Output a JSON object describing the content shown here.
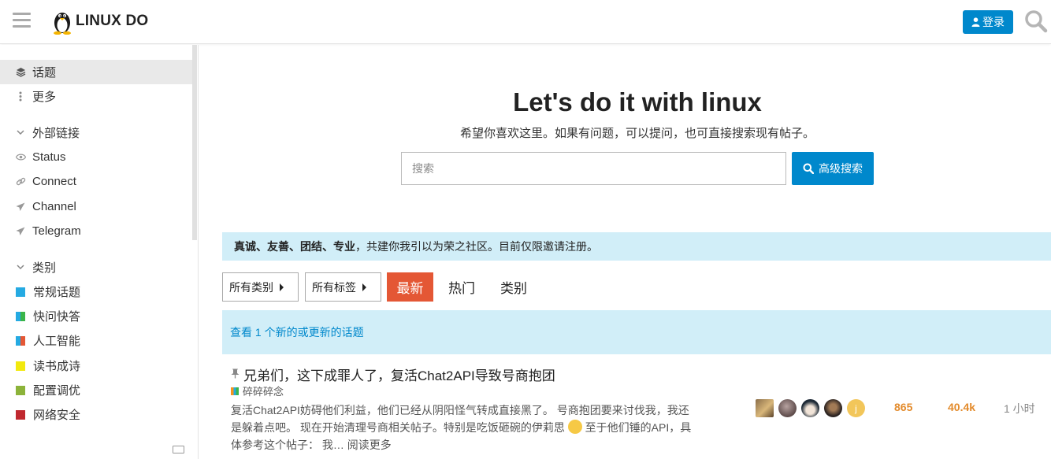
{
  "header": {
    "logo_text": "LINUX DO",
    "login_label": "登录"
  },
  "sidebar": {
    "items": [
      {
        "label": "话题",
        "icon": "layers-icon",
        "active": true
      },
      {
        "label": "更多",
        "icon": "vertical-ellipsis-icon",
        "active": false
      }
    ],
    "external_links": {
      "heading": "外部链接",
      "items": [
        {
          "label": "Status",
          "icon": "eye-icon"
        },
        {
          "label": "Connect",
          "icon": "link-icon"
        },
        {
          "label": "Channel",
          "icon": "send-icon"
        },
        {
          "label": "Telegram",
          "icon": "send-icon"
        }
      ]
    },
    "categories": {
      "heading": "类别",
      "items": [
        {
          "label": "常规话题",
          "color": "#25aae2"
        },
        {
          "label": "快问快答",
          "color": "#3ab54a"
        },
        {
          "label": "人工智能",
          "color": "#e45735"
        },
        {
          "label": "读书成诗",
          "color": "#f2e90e"
        },
        {
          "label": "配置调优",
          "color": "#8cb33a"
        },
        {
          "label": "网络安全",
          "color": "#c0282f"
        }
      ]
    }
  },
  "hero": {
    "title": "Let's do it with linux",
    "subtitle": "希望你喜欢这里。如果有问题，可以提问，也可直接搜索现有帖子。",
    "search_placeholder": "搜索",
    "advanced_search_label": "高级搜索"
  },
  "banner": {
    "bold_text": "真诚、友善、团结、专业",
    "text": "，共建你我引以为荣之社区。目前仅限邀请注册。"
  },
  "nav": {
    "all_categories": "所有类别",
    "all_tags": "所有标签",
    "tabs": [
      "最新",
      "热门",
      "类别"
    ],
    "active_tab": "最新"
  },
  "new_topics_notice": "查看 1 个新的或更新的话题",
  "topic": {
    "title": "兄弟们，这下成罪人了，复活Chat2API导致号商抱团",
    "category": "碎碎碎念",
    "excerpt_line1": "复活Chat2API妨碍他们利益，他们已经从阴阳怪气转成直接黑了。 号商抱团要来讨伐我，我还",
    "excerpt_line2_a": "是躲着点吧。 现在开始清理号商相关帖子。特别是吃饭砸碗的伊莉思",
    "excerpt_line2_b": "至于他们锤的API，具",
    "excerpt_line3": "体参考这个帖子： 我…",
    "read_more": "阅读更多",
    "replies": "865",
    "views": "40.4k",
    "activity": "1 小时"
  },
  "colors": {
    "accent": "#0088cc",
    "active_tab": "#e45735",
    "banner_bg": "#d1eef8",
    "stat": "#e38b2c"
  }
}
